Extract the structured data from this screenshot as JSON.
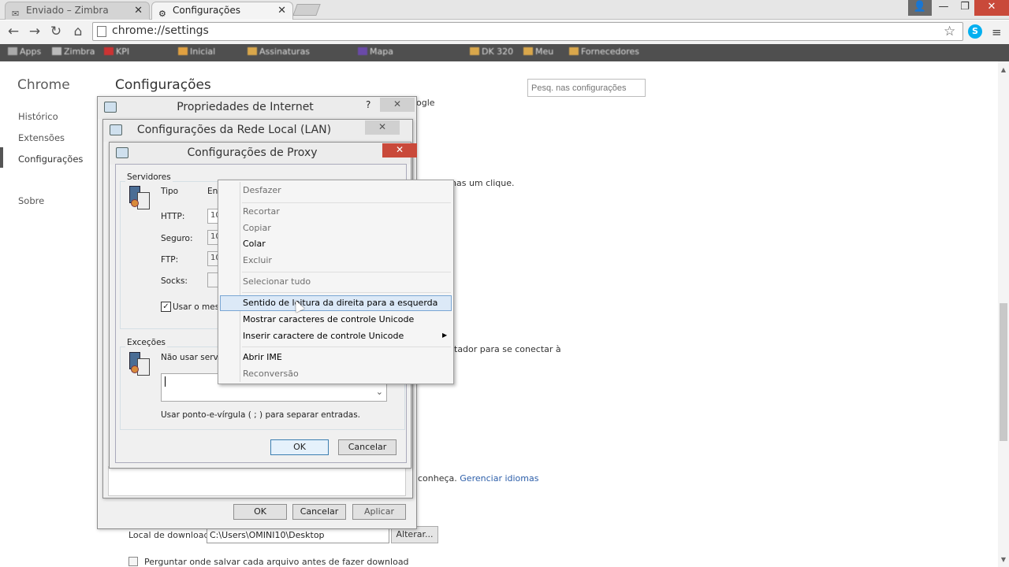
{
  "browser": {
    "tabs": [
      {
        "label": "Enviado – Zimbra",
        "active": false
      },
      {
        "label": "Configurações",
        "active": true
      }
    ],
    "window_controls": {
      "user": "👤",
      "minimize": "—",
      "restore": "❐",
      "close": "✕"
    },
    "nav": {
      "back": "←",
      "forward": "→",
      "reload": "↻",
      "home": "⌂"
    },
    "url": "chrome://settings",
    "icons": {
      "star": "☆",
      "skype": "S",
      "menu": "≡",
      "gear": "⚙"
    },
    "bookmarks": [
      {
        "label": "Apps",
        "icon": "apps-icon"
      },
      {
        "label": "Zimbra",
        "icon": "zimbra-icon"
      },
      {
        "label": "KPI",
        "icon": "kpi-icon"
      },
      {
        "label": "Inicial",
        "icon": "page-icon"
      },
      {
        "label": "Assinaturas",
        "icon": "folder-icon"
      },
      {
        "label": "Mapa",
        "icon": "map-icon"
      },
      {
        "label": "DK 320",
        "icon": "folder-icon"
      },
      {
        "label": "Meu",
        "icon": "folder-icon"
      },
      {
        "label": "Fornecedores",
        "icon": "folder-icon"
      }
    ]
  },
  "settings": {
    "brand": "Chrome",
    "title": "Configurações",
    "search_placeholder": "Pesq. nas configurações",
    "sidebar": [
      "Histórico",
      "Extensões",
      "Configurações",
      "Sobre"
    ],
    "bg_fragments": {
      "frag1": "ogle",
      "frag2": "nas um clique.",
      "frag3": "tador para se conectar à",
      "frag4": "conheça.",
      "frag4_link": "Gerenciar idiomas"
    },
    "download_label": "Local de download:",
    "download_path": "C:\\Users\\OMINI10\\Desktop",
    "alterar": "Alterar...",
    "ask_label": "Perguntar onde salvar cada arquivo antes de fazer download"
  },
  "internet_props": {
    "title": "Propriedades de Internet",
    "help": "?",
    "close": "✕",
    "ok": "OK",
    "cancel": "Cancelar",
    "apply": "Aplicar"
  },
  "lan": {
    "title": "Configurações da Rede Local (LAN)",
    "close": "✕"
  },
  "proxy": {
    "title": "Configurações de Proxy",
    "close": "✕",
    "servers_group": "Servidores",
    "col_type": "Tipo",
    "col_address": "En",
    "rows": [
      {
        "label": "HTTP:",
        "addr": "10",
        "port": ""
      },
      {
        "label": "Seguro:",
        "addr": "10",
        "port": ""
      },
      {
        "label": "FTP:",
        "addr": "10",
        "port": ""
      },
      {
        "label": "Socks:",
        "addr": "",
        "port": ""
      }
    ],
    "same_proxy_label": "Usar o mesm",
    "same_proxy_checked": "✓",
    "exceptions_group": "Exceções",
    "exceptions_label": "Não usar servid",
    "exceptions_hint": "Usar ponto-e-vírgula ( ; ) para separar entradas.",
    "dropdown_arrow": "⌄",
    "ok": "OK",
    "cancel": "Cancelar"
  },
  "context_menu": {
    "items": [
      {
        "label": "Desfazer",
        "enabled": false
      },
      {
        "label": "Recortar",
        "enabled": false
      },
      {
        "label": "Copiar",
        "enabled": false
      },
      {
        "label": "Colar",
        "enabled": true
      },
      {
        "label": "Excluir",
        "enabled": false
      },
      {
        "label": "Selecionar tudo",
        "enabled": false
      },
      {
        "label": "Sentido de leitura da direita para a esquerda",
        "enabled": true,
        "highlighted": true
      },
      {
        "label": "Mostrar caracteres de controle Unicode",
        "enabled": true
      },
      {
        "label": "Inserir caractere de controle Unicode",
        "enabled": true,
        "submenu": true
      },
      {
        "label": "Abrir IME",
        "enabled": true
      },
      {
        "label": "Reconversão",
        "enabled": false
      }
    ],
    "submenu_arrow": "▶"
  },
  "colors": {
    "bookmark_bar": "#4f4f4f",
    "close_red": "#c9493a",
    "highlight": "#dce9f7",
    "link": "#2c5ea9"
  }
}
